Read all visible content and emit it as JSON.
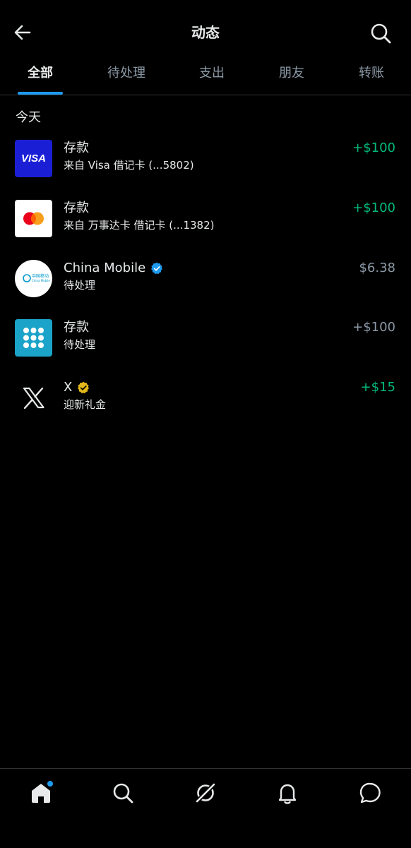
{
  "header": {
    "title": "动态"
  },
  "tabs": [
    {
      "label": "全部",
      "active": true
    },
    {
      "label": "待处理",
      "active": false
    },
    {
      "label": "支出",
      "active": false
    },
    {
      "label": "朋友",
      "active": false
    },
    {
      "label": "转账",
      "active": false
    }
  ],
  "section": {
    "label": "今天"
  },
  "transactions": [
    {
      "title": "存款",
      "subtitle": "来自 Visa 借记卡 (...5802)",
      "amount": "+$100",
      "amount_color": "#00ba7c",
      "logo": "visa-logo",
      "logo_text": "VISA"
    },
    {
      "title": "存款",
      "subtitle": "来自 万事达卡 借记卡 (...1382)",
      "amount": "+$100",
      "amount_color": "#00ba7c",
      "logo": "mastercard-logo"
    },
    {
      "title": "China Mobile",
      "subtitle": "待处理",
      "amount": "$6.38",
      "amount_color": "#8b98a5",
      "logo": "china-mobile-logo",
      "verified": "blue",
      "logo_text_cn": "中国移动",
      "logo_text_en": "China Mobile"
    },
    {
      "title": "存款",
      "subtitle": "待处理",
      "amount": "+$100",
      "amount_color": "#8b98a5",
      "logo": "bank-dots-logo"
    },
    {
      "title": "X",
      "subtitle": "迎新礼金",
      "amount": "+$15",
      "amount_color": "#00ba7c",
      "logo": "x-logo",
      "verified": "gold"
    }
  ],
  "bottom_nav": [
    {
      "name": "home-icon",
      "active": true,
      "badge": true
    },
    {
      "name": "search-icon"
    },
    {
      "name": "grok-icon"
    },
    {
      "name": "bell-icon"
    },
    {
      "name": "messages-icon"
    }
  ],
  "colors": {
    "accent": "#1d9bf0",
    "positive": "#00ba7c",
    "muted": "#8b98a5",
    "verified_gold": "#e2b719"
  }
}
